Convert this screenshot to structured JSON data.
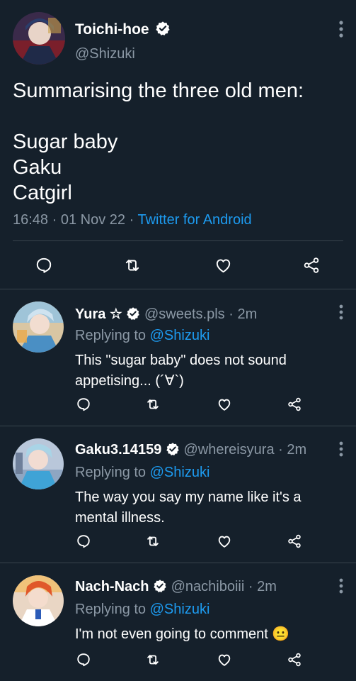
{
  "main_tweet": {
    "display_name": "Toichi-hoe",
    "handle": "@Shizuki",
    "text_lines": [
      "Summarising the three old men:",
      "",
      "Sugar baby",
      "Gaku",
      "Catgirl"
    ],
    "time": "16:48",
    "date": "01 Nov 22",
    "client": "Twitter for Android",
    "separator": "·"
  },
  "replies": [
    {
      "display_name": "Yura ☆",
      "handle": "@sweets.pls",
      "age": "2m",
      "replying_prefix": "Replying to",
      "replying_to": "@Shizuki",
      "text": "This \"sugar baby\" does not sound appetising... (´∀`)"
    },
    {
      "display_name": "Gaku3.14159",
      "handle": "@whereisyura",
      "age": "2m",
      "replying_prefix": "Replying to",
      "replying_to": "@Shizuki",
      "text": "The way you say my name like it's a mental illness."
    },
    {
      "display_name": "Nach-Nach",
      "handle": "@nachiboiii",
      "age": "2m",
      "replying_prefix": "Replying to",
      "replying_to": "@Shizuki",
      "text": "I'm not even going to comment 😐"
    }
  ],
  "icons": {
    "reply": "speech-bubble-icon",
    "retweet": "retweet-icon",
    "like": "heart-icon",
    "share": "share-icon",
    "verified": "verified-badge-icon",
    "more": "more-vertical-icon"
  },
  "colors": {
    "background": "#15202b",
    "text": "#ffffff",
    "secondary": "#8b98a5",
    "link": "#1d9bf0",
    "divider": "#38444d"
  }
}
